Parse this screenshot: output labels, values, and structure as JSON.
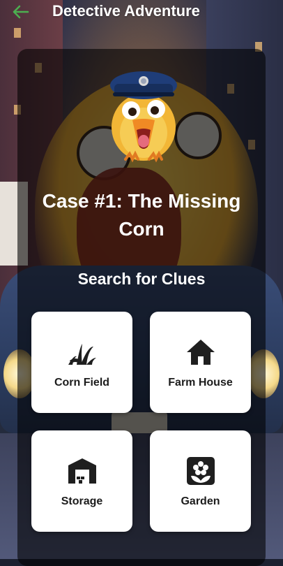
{
  "app_bar": {
    "title": "Detective Adventure",
    "back_icon": "arrow-back-icon",
    "accent_color": "#4caf50"
  },
  "case": {
    "title": "Case #1: The Missing Corn"
  },
  "clues": {
    "heading": "Search for Clues",
    "locations": [
      {
        "label": "Corn Field",
        "icon": "grass-icon"
      },
      {
        "label": "Farm House",
        "icon": "house-icon"
      },
      {
        "label": "Storage",
        "icon": "warehouse-icon"
      },
      {
        "label": "Garden",
        "icon": "flower-icon"
      }
    ]
  },
  "colors": {
    "tile_bg": "#ffffff",
    "panel_bg": "rgba(0,0,0,0.58)",
    "text_primary": "#ffffff",
    "tile_text": "#1c1c1c"
  }
}
